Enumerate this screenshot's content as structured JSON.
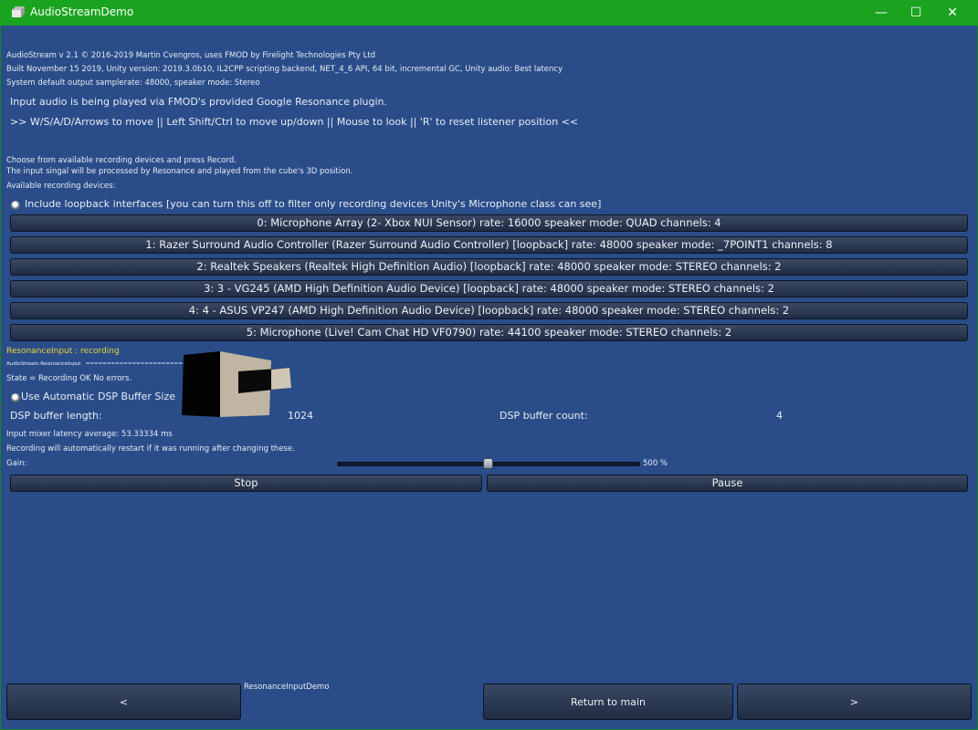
{
  "window": {
    "title": "AudioStreamDemo",
    "minimize_label": "—",
    "maximize_label": "☐",
    "close_label": "✕"
  },
  "info": {
    "line1": "AudioStream v 2.1 © 2016-2019 Martin Cvengros, uses FMOD by Firelight Technologies Pty Ltd",
    "line2": "Built November 15 2019, Unity version: 2019.3.0b10, IL2CPP scripting backend, NET_4_6 API, 64 bit, incremental GC,  Unity audio: Best latency",
    "line3": "System default output samplerate: 48000, speaker mode: Stereo",
    "resonance_note": "Input audio is being played via FMOD's provided Google Resonance plugin.",
    "controls_note": ">> W/S/A/D/Arrows to move || Left Shift/Ctrl to move up/down || Mouse to look || 'R' to reset listener position <<",
    "choose_line": "Choose from available recording devices and press Record.",
    "process_line": "The input singal will be processed by Resonance and played from the cube's 3D position.",
    "available_label": "Available recording devices:"
  },
  "loopback_toggle": {
    "label": "Include loopback interfaces [you can turn this off to filter only recording devices Unity's Microphone class can see]",
    "checked": true
  },
  "devices": [
    "0: Microphone Array (2- Xbox NUI Sensor) rate: 16000 speaker mode: QUAD channels: 4",
    "1: Razer Surround Audio Controller (Razer Surround Audio Controller) [loopback] rate: 48000 speaker mode: _7POINT1 channels: 8",
    "2: Realtek Speakers (Realtek High Definition Audio) [loopback] rate: 48000 speaker mode: STEREO channels: 2",
    "3: 3 - VG245 (AMD High Definition Audio Device) [loopback] rate: 48000 speaker mode: STEREO channels: 2",
    "4: 4 - ASUS VP247 (AMD High Definition Audio Device) [loopback] rate: 48000 speaker mode: STEREO channels: 2",
    "5: Microphone (Live! Cam Chat HD VF0790) rate: 44100 speaker mode: STEREO channels: 2"
  ],
  "status": {
    "recording_label": "ResonanceInput : recording",
    "component_name": "AudioStream.ResonanceInput",
    "component_dashes": "====================================",
    "state_text": "State = Recording OK No errors."
  },
  "dsp": {
    "auto_label": "Use Automatic DSP Buffer Size",
    "auto_checked": true,
    "length_label": "DSP buffer length:",
    "length_value": "1024",
    "count_label": "DSP buffer count:",
    "count_value": "4",
    "latency_text": "Input mixer latency average: 53.33334 ms",
    "restart_note": "Recording will automatically restart if it was running after changing these."
  },
  "gain": {
    "label": "Gain:",
    "value_text": "500 %",
    "fraction": 0.5
  },
  "actions": {
    "stop_label": "Stop",
    "pause_label": "Pause"
  },
  "nav": {
    "scene_name": "ResonanceInputDemo",
    "prev_label": "<",
    "main_label": "Return to main",
    "next_label": ">"
  },
  "colors": {
    "titlebar": "#1aa31f",
    "background": "#2a4d8a",
    "recording_text": "#e9d52e"
  }
}
